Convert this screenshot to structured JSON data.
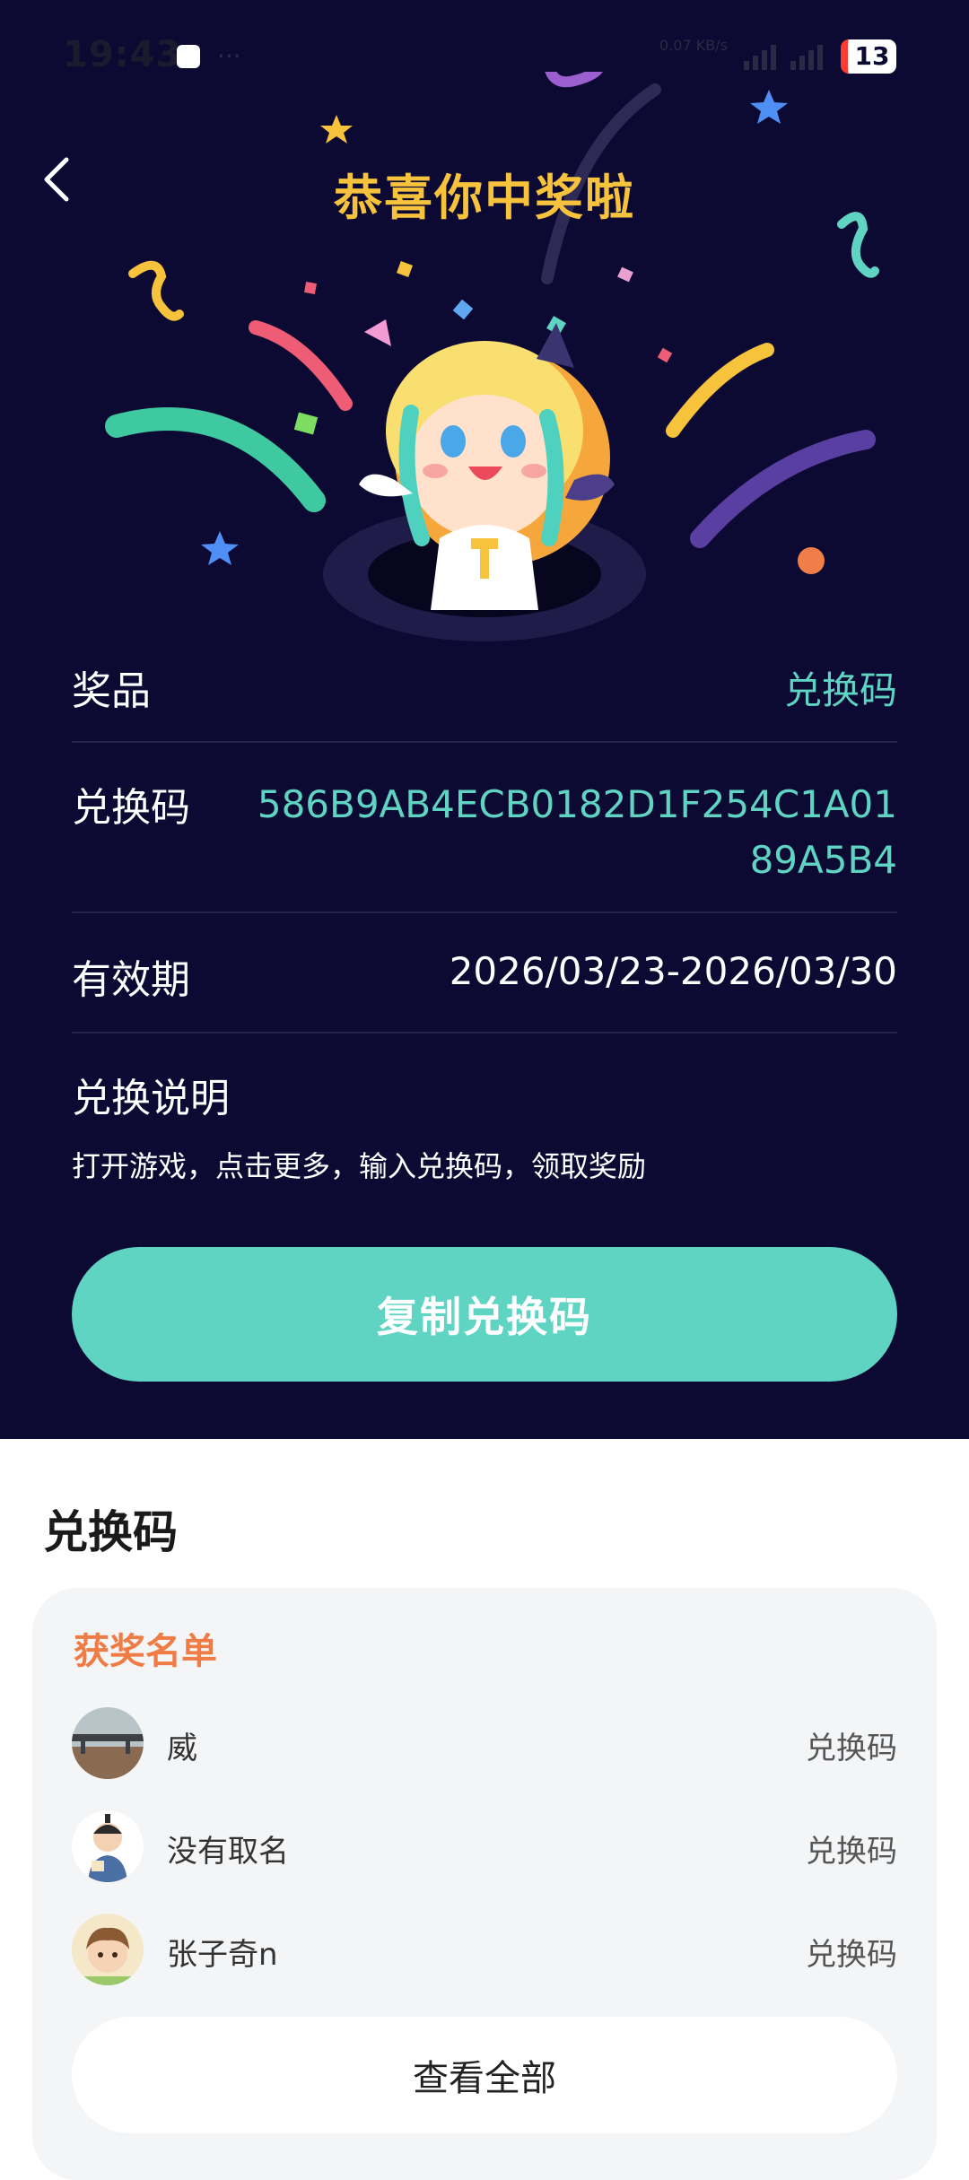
{
  "status_bar": {
    "time": "19:43",
    "speed": "0.07 KB/s",
    "battery": "13"
  },
  "header": {
    "title": "恭喜你中奖啦"
  },
  "prize_info": {
    "prize_label": "奖品",
    "prize_value": "兑换码",
    "code_label": "兑换码",
    "code_value_line1": "586B9AB4ECB0182D1F254C1A01",
    "code_value_line2": "89A5B4",
    "validity_label": "有效期",
    "validity_value": "2026/03/23-2026/03/30",
    "instructions_label": "兑换说明",
    "instructions_text": "打开游戏，点击更多，输入兑换码，领取奖励"
  },
  "copy_button_label": "复制兑换码",
  "section": {
    "title": "兑换码",
    "winners_title": "获奖名单",
    "winners": [
      {
        "name": "威",
        "prize": "兑换码"
      },
      {
        "name": "没有取名",
        "prize": "兑换码"
      },
      {
        "name": "张子奇n",
        "prize": "兑换码"
      }
    ],
    "view_all_label": "查看全部"
  },
  "colors": {
    "background": "#0c0a33",
    "accent_teal": "#5fd4c3",
    "title_gold": "#f7c33d",
    "winners_orange": "#ef7b45"
  }
}
